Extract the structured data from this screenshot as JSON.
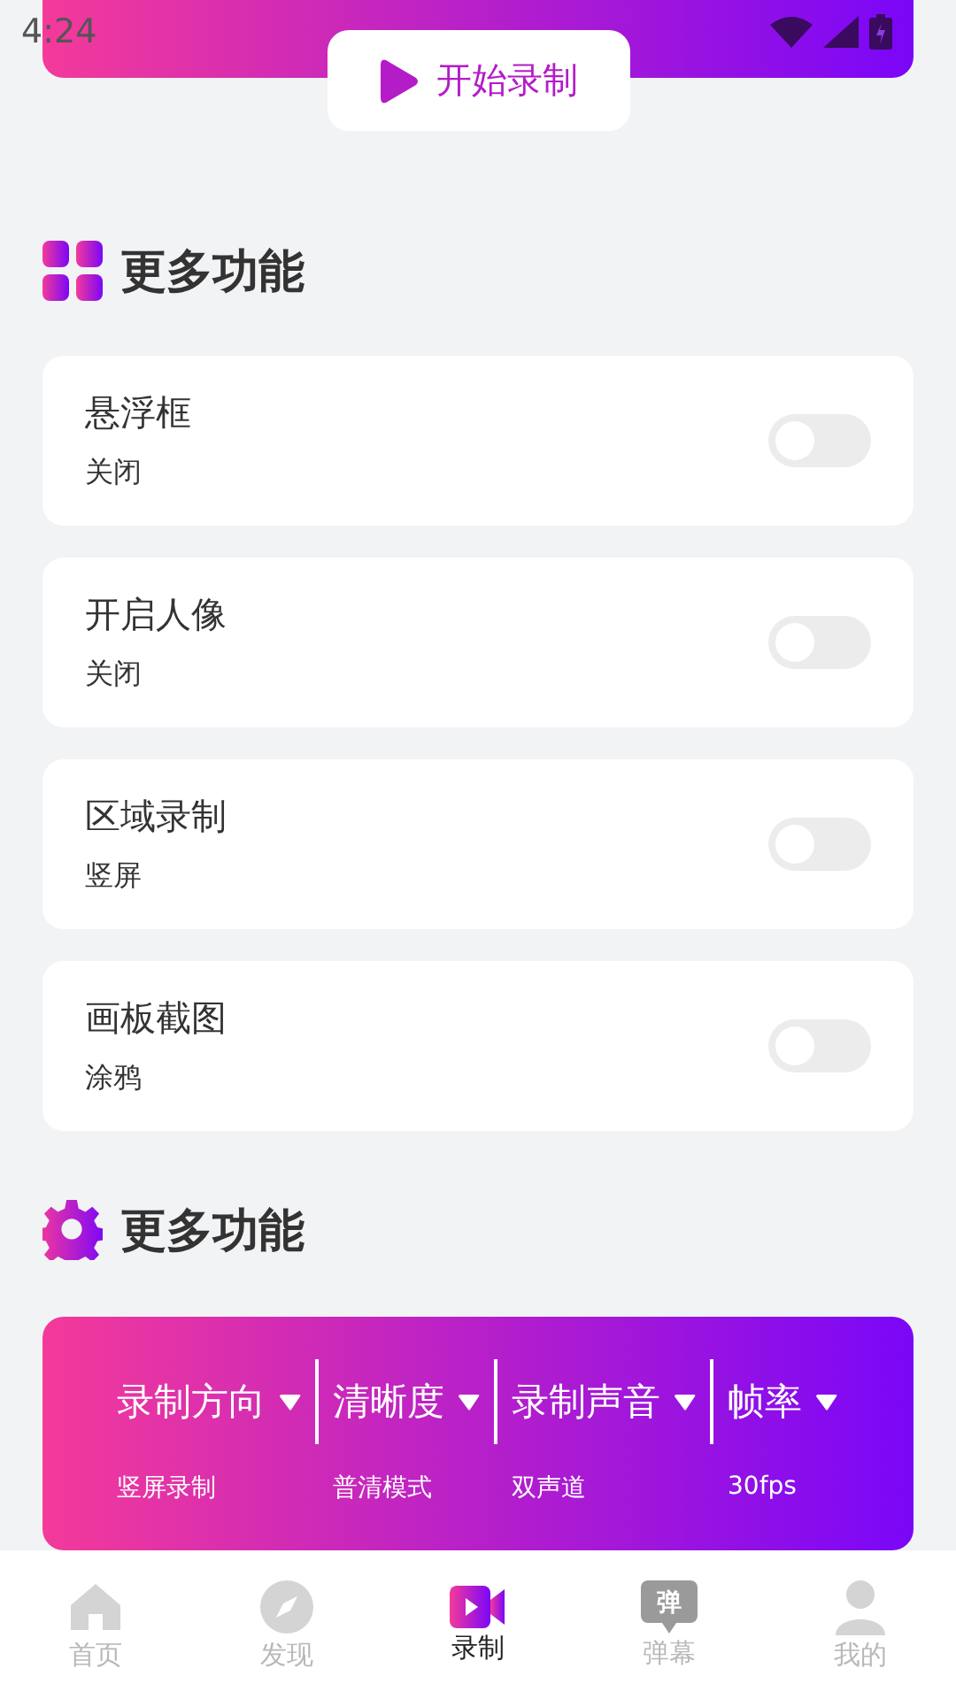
{
  "status_bar": {
    "time": "4:24"
  },
  "record_button": {
    "label": "开始录制"
  },
  "sections": [
    {
      "title": "更多功能",
      "kind": "grid"
    },
    {
      "title": "更多功能",
      "kind": "gear"
    }
  ],
  "features": [
    {
      "title": "悬浮框",
      "subtitle": "关闭",
      "on": false
    },
    {
      "title": "开启人像",
      "subtitle": "关闭",
      "on": false
    },
    {
      "title": "区域录制",
      "subtitle": "竖屏",
      "on": false
    },
    {
      "title": "画板截图",
      "subtitle": "涂鸦",
      "on": false
    }
  ],
  "settings": [
    {
      "label": "录制方向",
      "value": "竖屏录制"
    },
    {
      "label": "清晰度",
      "value": "普清模式"
    },
    {
      "label": "录制声音",
      "value": "双声道"
    },
    {
      "label": "帧率",
      "value": "30fps"
    }
  ],
  "tabs": [
    {
      "label": "首页",
      "kind": "home",
      "selected": false
    },
    {
      "label": "发现",
      "kind": "compass",
      "selected": false
    },
    {
      "label": "录制",
      "kind": "video",
      "selected": true
    },
    {
      "label": "弹幕",
      "kind": "bubble",
      "icon_text": "弹",
      "selected": false
    },
    {
      "label": "我的",
      "kind": "person",
      "selected": false
    }
  ]
}
